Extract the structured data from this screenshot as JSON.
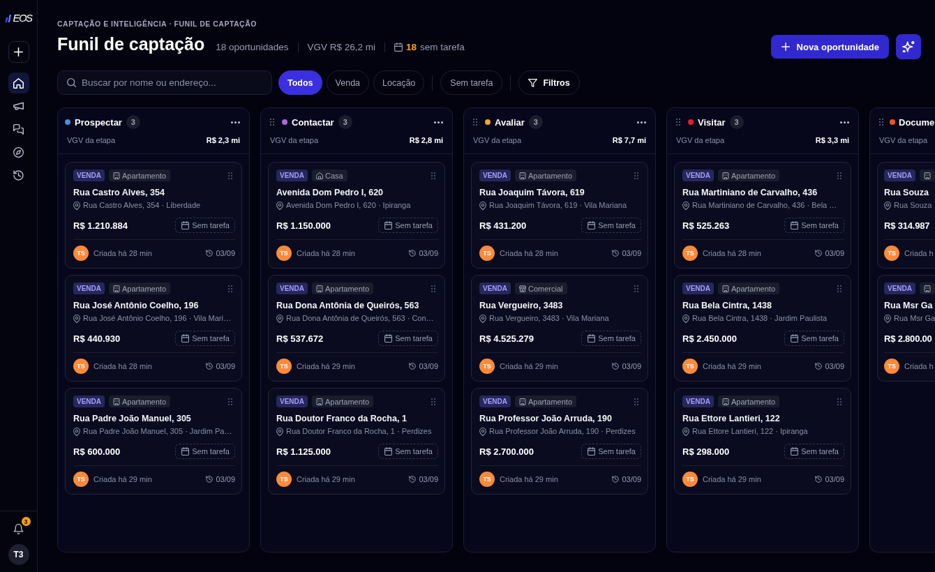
{
  "sidebar": {
    "logo": "EOS",
    "nav": [
      {
        "kind": "add",
        "selected": false
      },
      {
        "kind": "home",
        "selected": true
      },
      {
        "kind": "megaphone",
        "selected": false
      },
      {
        "kind": "chat",
        "selected": false
      },
      {
        "kind": "compass",
        "selected": false
      },
      {
        "kind": "history",
        "selected": false
      }
    ],
    "notifications": {
      "badge": "3"
    },
    "avatar": "T3"
  },
  "header": {
    "breadcrumb": "CAPTAÇÃO E INTELIGÊNCIA · FUNIL DE CAPTAÇÃO",
    "title": "Funil de captação",
    "stats": [
      {
        "kind": "text",
        "text": "18 oportunidades"
      },
      {
        "kind": "text",
        "text": "VGV R$ 26,2 mi"
      },
      {
        "kind": "tasks",
        "count": "18",
        "text": "sem tarefa"
      }
    ],
    "actions": [
      {
        "kind": "primary",
        "label": "Nova oportunidade"
      },
      {
        "kind": "sparkle"
      }
    ]
  },
  "filters": {
    "search": {
      "placeholder": "Buscar por nome ou endereço..."
    },
    "chips": [
      {
        "label": "Todos",
        "selected": true
      },
      {
        "label": "Venda",
        "selected": false
      },
      {
        "label": "Locação",
        "selected": false
      }
    ],
    "toggles": [
      {
        "label": "Sem tarefa",
        "selected": false
      }
    ],
    "filter_button": {
      "label": "Filtros"
    }
  },
  "board": {
    "columns": [
      {
        "title": "Prospectar",
        "color": "#4a8fe0",
        "count": "3",
        "draggable": false,
        "cut_off": false,
        "value_label": "VGV da etapa",
        "value": "R$ 2,3 mi",
        "cards": [
          {
            "deal": "VENDA",
            "kind": "apartment",
            "type": "Apartamento",
            "title": "Rua Castro Alves, 354",
            "address": "Rua Castro Alves, 354 · Liberdade",
            "price": "R$ 1.210.884",
            "task": "Sem tarefa",
            "owner": "TS",
            "created": "Criada há 28 min",
            "date": "03/09"
          },
          {
            "deal": "VENDA",
            "kind": "apartment",
            "type": "Apartamento",
            "title": "Rua José Antônio Coelho, 196",
            "address": "Rua José Antônio Coelho, 196 · Vila Mari…",
            "price": "R$ 440.930",
            "task": "Sem tarefa",
            "owner": "TS",
            "created": "Criada há 28 min",
            "date": "03/09"
          },
          {
            "deal": "VENDA",
            "kind": "apartment",
            "type": "Apartamento",
            "title": "Rua Padre João Manuel, 305",
            "address": "Rua Padre João Manuel, 305 · Jardim Pa…",
            "price": "R$ 600.000",
            "task": "Sem tarefa",
            "owner": "TS",
            "created": "Criada há 29 min",
            "date": "03/09"
          }
        ]
      },
      {
        "title": "Contactar",
        "color": "#b266e0",
        "count": "3",
        "draggable": true,
        "cut_off": false,
        "value_label": "VGV da etapa",
        "value": "R$ 2,8 mi",
        "cards": [
          {
            "deal": "VENDA",
            "kind": "house",
            "type": "Casa",
            "title": "Avenida Dom Pedro I, 620",
            "address": "Avenida Dom Pedro I, 620 · Ipiranga",
            "price": "R$ 1.150.000",
            "task": "Sem tarefa",
            "owner": "TS",
            "created": "Criada há 28 min",
            "date": "03/09"
          },
          {
            "deal": "VENDA",
            "kind": "apartment",
            "type": "Apartamento",
            "title": "Rua Dona Antônia de Queirós, 563",
            "address": "Rua Dona Antônia de Queirós, 563 · Con…",
            "price": "R$ 537.672",
            "task": "Sem tarefa",
            "owner": "TS",
            "created": "Criada há 29 min",
            "date": "03/09"
          },
          {
            "deal": "VENDA",
            "kind": "apartment",
            "type": "Apartamento",
            "title": "Rua Doutor Franco da Rocha, 1",
            "address": "Rua Doutor Franco da Rocha, 1 · Perdizes",
            "price": "R$ 1.125.000",
            "task": "Sem tarefa",
            "owner": "TS",
            "created": "Criada há 29 min",
            "date": "03/09"
          }
        ]
      },
      {
        "title": "Avaliar",
        "color": "#f5a623",
        "count": "3",
        "draggable": true,
        "cut_off": false,
        "value_label": "VGV da etapa",
        "value": "R$ 7,7 mi",
        "cards": [
          {
            "deal": "VENDA",
            "kind": "apartment",
            "type": "Apartamento",
            "title": "Rua Joaquim Távora, 619",
            "address": "Rua Joaquim Távora, 619 · Vila Mariana",
            "price": "R$ 431.200",
            "task": "Sem tarefa",
            "owner": "TS",
            "created": "Criada há 28 min",
            "date": "03/09"
          },
          {
            "deal": "VENDA",
            "kind": "commercial",
            "type": "Comercial",
            "title": "Rua Vergueiro, 3483",
            "address": "Rua Vergueiro, 3483 · Vila Mariana",
            "price": "R$ 4.525.279",
            "task": "Sem tarefa",
            "owner": "TS",
            "created": "Criada há 29 min",
            "date": "03/09"
          },
          {
            "deal": "VENDA",
            "kind": "apartment",
            "type": "Apartamento",
            "title": "Rua Professor João Arruda, 190",
            "address": "Rua Professor João Arruda, 190 · Perdizes",
            "price": "R$ 2.700.000",
            "task": "Sem tarefa",
            "owner": "TS",
            "created": "Criada há 29 min",
            "date": "03/09"
          }
        ]
      },
      {
        "title": "Visitar",
        "color": "#ec1c24",
        "count": "3",
        "draggable": true,
        "cut_off": false,
        "value_label": "VGV da etapa",
        "value": "R$ 3,3 mi",
        "cards": [
          {
            "deal": "VENDA",
            "kind": "apartment",
            "type": "Apartamento",
            "title": "Rua Martiniano de Carvalho, 436",
            "address": "Rua Martiniano de Carvalho, 436 · Bela …",
            "price": "R$ 525.263",
            "task": "Sem tarefa",
            "owner": "TS",
            "created": "Criada há 28 min",
            "date": "03/09"
          },
          {
            "deal": "VENDA",
            "kind": "apartment",
            "type": "Apartamento",
            "title": "Rua Bela Cintra, 1438",
            "address": "Rua Bela Cintra, 1438 · Jardim Paulista",
            "price": "R$ 2.450.000",
            "task": "Sem tarefa",
            "owner": "TS",
            "created": "Criada há 29 min",
            "date": "03/09"
          },
          {
            "deal": "VENDA",
            "kind": "apartment",
            "type": "Apartamento",
            "title": "Rua Ettore Lantieri, 122",
            "address": "Rua Ettore Lantieri, 122 · Ipiranga",
            "price": "R$ 298.000",
            "task": "Sem tarefa",
            "owner": "TS",
            "created": "Criada há 29 min",
            "date": "03/09"
          }
        ]
      },
      {
        "title": "Docume",
        "color": "#f4511e",
        "draggable": true,
        "cut_off": true,
        "value_label": "VGV da etapa",
        "cards": [
          {
            "deal": "VENDA",
            "kind": "apartment",
            "title": "Rua Souza",
            "address": "Rua Souza",
            "price": "R$ 314.987",
            "owner": "TS",
            "created": "Criada h"
          },
          {
            "deal": "VENDA",
            "kind": "apartment",
            "title": "Rua Msr Ga",
            "address": "Rua Msr Ga",
            "price": "R$ 2.800.00",
            "owner": "TS",
            "created": "Criada h"
          }
        ]
      }
    ]
  }
}
